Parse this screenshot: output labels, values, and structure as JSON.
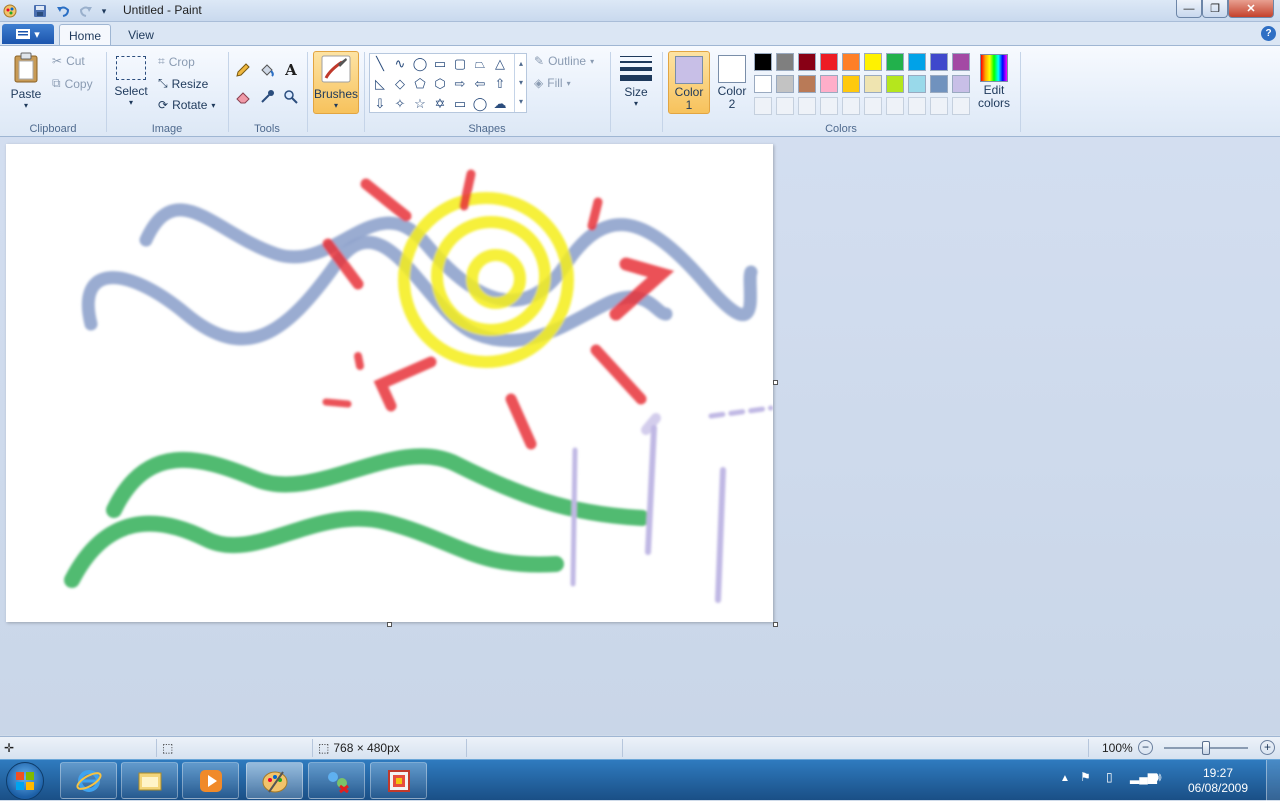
{
  "window": {
    "title": "Untitled - Paint",
    "buttons": {
      "minimize": "—",
      "maximize": "❐",
      "close": "✕"
    }
  },
  "quick_access": [
    "save-icon",
    "undo-icon",
    "redo-icon",
    "customize-icon"
  ],
  "tabs": [
    {
      "label": "Home",
      "active": true
    },
    {
      "label": "View",
      "active": false
    }
  ],
  "ribbon": {
    "clipboard": {
      "label": "Clipboard",
      "paste": "Paste",
      "cut": "Cut",
      "copy": "Copy"
    },
    "image": {
      "label": "Image",
      "select": "Select",
      "crop": "Crop",
      "resize": "Resize",
      "rotate": "Rotate"
    },
    "tools": {
      "label": "Tools"
    },
    "brushes": {
      "label": "Brushes"
    },
    "shapes": {
      "label": "Shapes",
      "outline": "Outline",
      "fill": "Fill"
    },
    "size": {
      "label": "Size"
    },
    "colors": {
      "label": "Colors",
      "color1": {
        "label": "Color\n1",
        "value": "#c8bfe7"
      },
      "color2": {
        "label": "Color\n2",
        "value": "#ffffff"
      },
      "edit": "Edit\ncolors",
      "palette_row1": [
        "#000000",
        "#7f7f7f",
        "#880015",
        "#ed1c24",
        "#ff7f27",
        "#fff200",
        "#22b14c",
        "#00a2e8",
        "#3f48cc",
        "#a349a4"
      ],
      "palette_row2": [
        "#ffffff",
        "#c3c3c3",
        "#b97a57",
        "#ffaec9",
        "#ffc90e",
        "#efe4b0",
        "#b5e61d",
        "#99d9ea",
        "#7092be",
        "#c8bfe7"
      ]
    }
  },
  "status": {
    "canvas_size": "768 × 480px",
    "zoom": "100%",
    "zoom_fraction": 0.5
  },
  "taskbar": {
    "apps": [
      "internet-explorer-icon",
      "windows-explorer-icon",
      "media-player-icon",
      "paint-icon",
      "network-icon",
      "remote-app-icon"
    ],
    "time": "19:27",
    "date": "06/08/2009"
  }
}
